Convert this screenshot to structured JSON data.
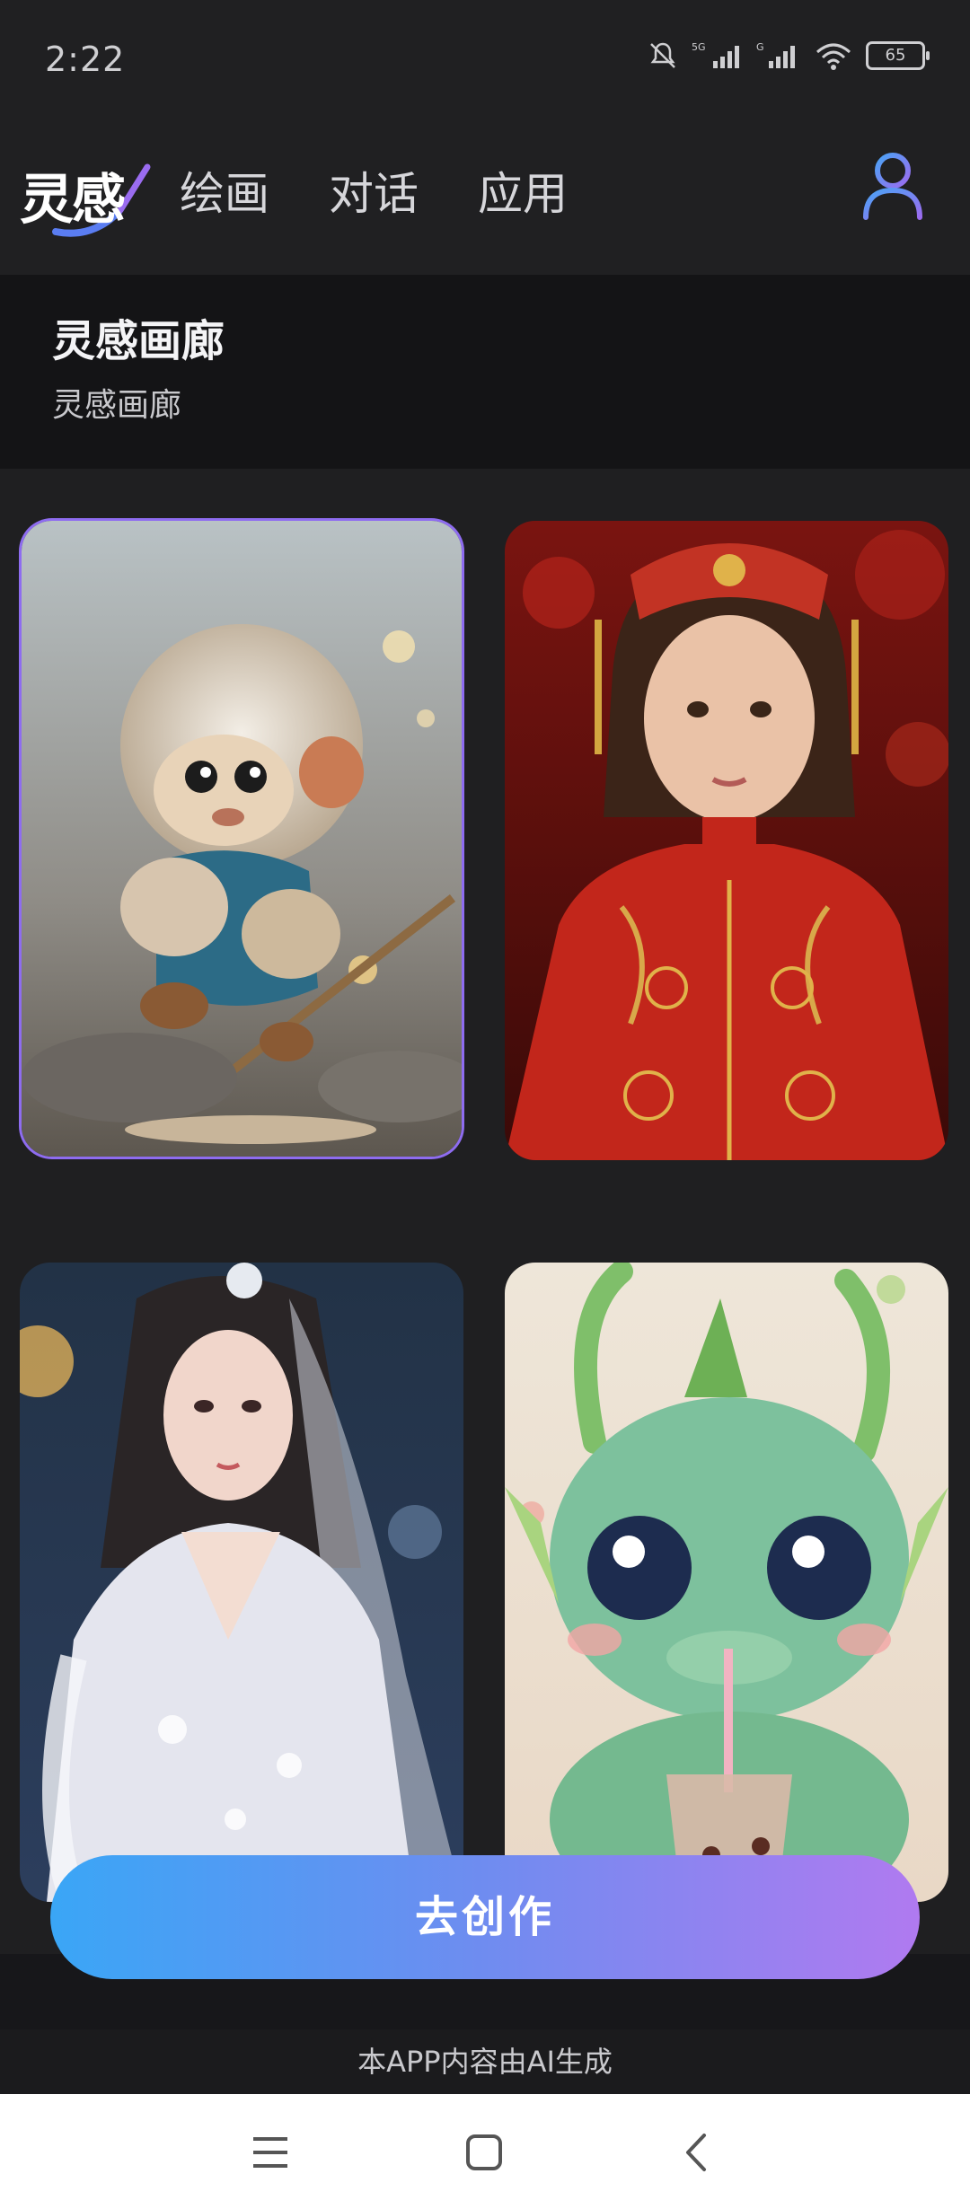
{
  "status_bar": {
    "time": "2:22",
    "battery": "65",
    "icons": [
      "bell-muted-icon",
      "signal-5g-icon",
      "signal-g-icon",
      "wifi-icon",
      "battery-icon"
    ]
  },
  "nav": {
    "logo_text": "灵感",
    "tabs": [
      "绘画",
      "对话",
      "应用"
    ],
    "user_icon": "user-icon"
  },
  "gallery": {
    "title": "灵感画廊",
    "subtitle": "灵感画廊",
    "cards": [
      {
        "subject": "monkey-character-image",
        "selected": true
      },
      {
        "subject": "girl-in-red-qipao-image",
        "selected": false
      },
      {
        "subject": "woman-in-white-hanfu-image",
        "selected": false
      },
      {
        "subject": "baby-dragon-with-drink-image",
        "selected": false
      }
    ]
  },
  "cta": {
    "label": "去创作"
  },
  "footer_note": "本APP内容由AI生成",
  "system_nav": [
    "menu-icon",
    "home-icon",
    "back-icon"
  ],
  "colors": {
    "background": "#1f1f21",
    "header_band": "#141416",
    "gradient_start": "#3aa6f6",
    "gradient_end": "#b07af0",
    "accent_user_icon": "#6b7cf5"
  }
}
